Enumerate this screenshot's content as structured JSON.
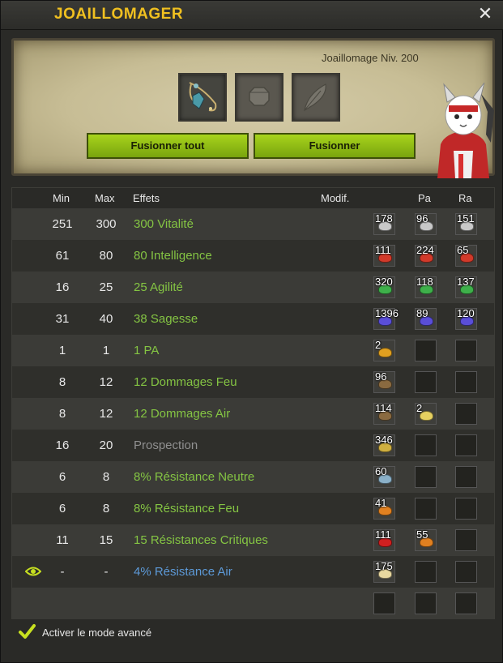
{
  "window": {
    "title": "JOAILLOMAGER",
    "close_icon": "close-icon"
  },
  "forge": {
    "level_text": "Joaillomage Niv. 200",
    "slots": [
      {
        "name": "item-slot",
        "icon": "amulet-icon"
      },
      {
        "name": "rune-slot",
        "icon": "rune-placeholder-icon"
      },
      {
        "name": "potion-slot",
        "icon": "feather-icon"
      }
    ],
    "fuse_all_label": "Fusionner tout",
    "fuse_label": "Fusionner"
  },
  "table": {
    "headers": {
      "min": "Min",
      "max": "Max",
      "effects": "Effets",
      "modif": "Modif.",
      "pa": "Pa",
      "ra": "Ra"
    },
    "rows": [
      {
        "min": "251",
        "max": "300",
        "effect": "300 Vitalité",
        "style": "green",
        "runes": [
          {
            "count": "178",
            "color": "#c8c8c8"
          },
          {
            "count": "96",
            "color": "#c8c8c8"
          },
          {
            "count": "151",
            "color": "#c8c8c8"
          }
        ]
      },
      {
        "min": "61",
        "max": "80",
        "effect": "80 Intelligence",
        "style": "green",
        "runes": [
          {
            "count": "111",
            "color": "#d23a2a"
          },
          {
            "count": "224",
            "color": "#d23a2a"
          },
          {
            "count": "65",
            "color": "#d23a2a"
          }
        ]
      },
      {
        "min": "16",
        "max": "25",
        "effect": "25 Agilité",
        "style": "green",
        "runes": [
          {
            "count": "320",
            "color": "#3eb04a"
          },
          {
            "count": "118",
            "color": "#3eb04a"
          },
          {
            "count": "137",
            "color": "#3eb04a"
          }
        ]
      },
      {
        "min": "31",
        "max": "40",
        "effect": "38 Sagesse",
        "style": "green",
        "runes": [
          {
            "count": "1396",
            "color": "#5a4ed8"
          },
          {
            "count": "89",
            "color": "#5a4ed8"
          },
          {
            "count": "120",
            "color": "#5a4ed8"
          }
        ]
      },
      {
        "min": "1",
        "max": "1",
        "effect": "1 PA",
        "style": "green",
        "runes": [
          {
            "count": "2",
            "color": "#e0a020"
          },
          null,
          null
        ]
      },
      {
        "min": "8",
        "max": "12",
        "effect": "12 Dommages Feu",
        "style": "green",
        "runes": [
          {
            "count": "96",
            "color": "#8a6a40"
          },
          null,
          null
        ]
      },
      {
        "min": "8",
        "max": "12",
        "effect": "12 Dommages Air",
        "style": "green",
        "runes": [
          {
            "count": "114",
            "color": "#8a6a40"
          },
          {
            "count": "2",
            "color": "#e6d060"
          },
          null
        ]
      },
      {
        "min": "16",
        "max": "20",
        "effect": "Prospection",
        "style": "grey",
        "runes": [
          {
            "count": "346",
            "color": "#d0b040"
          },
          null,
          null
        ]
      },
      {
        "min": "6",
        "max": "8",
        "effect": "8% Résistance Neutre",
        "style": "green",
        "runes": [
          {
            "count": "60",
            "color": "#8ab0c8"
          },
          null,
          null
        ]
      },
      {
        "min": "6",
        "max": "8",
        "effect": "8% Résistance Feu",
        "style": "green",
        "runes": [
          {
            "count": "41",
            "color": "#e08020"
          },
          null,
          null
        ]
      },
      {
        "min": "11",
        "max": "15",
        "effect": "15 Résistances Critiques",
        "style": "green",
        "runes": [
          {
            "count": "111",
            "color": "#d02020"
          },
          {
            "count": "55",
            "color": "#e08020"
          },
          null
        ]
      },
      {
        "min": "-",
        "max": "-",
        "effect": "4% Résistance Air",
        "style": "blue",
        "eye": true,
        "runes": [
          {
            "count": "175",
            "color": "#e8d8a0"
          },
          null,
          null
        ]
      },
      {
        "min": "",
        "max": "",
        "effect": "",
        "style": "green",
        "runes": [
          null,
          null,
          null
        ]
      }
    ]
  },
  "footer": {
    "advanced_mode_label": "Activer le mode avancé",
    "checked": true
  }
}
